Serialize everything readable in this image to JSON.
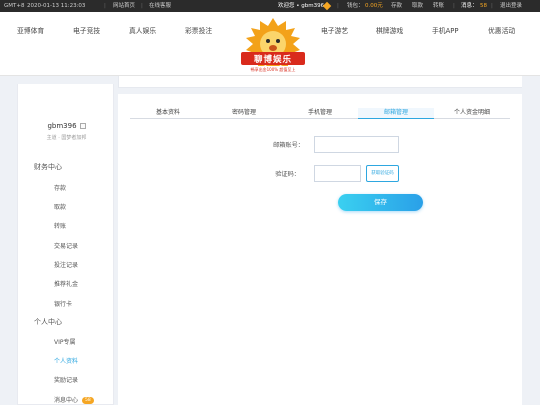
{
  "topbar": {
    "timezone": "GMT+8",
    "datetime": "2020-01-13 11:23:03",
    "home_link": "网站首页",
    "service_link": "在线客服",
    "welcome": "欢迎您 • gbm396",
    "wallet_label": "钱包：",
    "wallet_value": "0.00元",
    "deposit": "存款",
    "withdraw": "取款",
    "transfer": "转账",
    "message_label": "消息：",
    "message_count": "58",
    "logout": "退出登录"
  },
  "nav": {
    "items_left": [
      "亚博体育",
      "电子竞技",
      "真人娱乐",
      "彩票投注"
    ],
    "items_right": [
      "电子游艺",
      "棋牌游戏",
      "手机APP",
      "优惠活动"
    ],
    "logo_text": "聊博娱乐",
    "logo_slogan": "畅享出金100% 超值至上"
  },
  "sidebar": {
    "username": "gbm396",
    "level": "主道 · 国梦者加邦",
    "finance_title": "财务中心",
    "finance_items": [
      "存款",
      "取款",
      "转账",
      "交易记录",
      "投注记录",
      "推荐礼金",
      "银行卡"
    ],
    "personal_title": "个人中心",
    "personal_items": [
      "VIP专属",
      "个人资料",
      "奖励记录",
      "消息中心"
    ],
    "message_badge": "58"
  },
  "tabs": [
    "基本资料",
    "密码管理",
    "手机管理",
    "邮箱管理",
    "个人资金明细"
  ],
  "active_tab": 3,
  "form": {
    "email_label": "邮箱账号：",
    "email_value": "",
    "code_label": "验证码：",
    "code_value": "",
    "get_code_button": "获取验证码",
    "save_button": "保存"
  },
  "colors": {
    "accent": "#2ea7e0",
    "topbar_bg": "#2b2b2b",
    "highlight": "#f5a623",
    "page_bg": "#eef1f6"
  }
}
